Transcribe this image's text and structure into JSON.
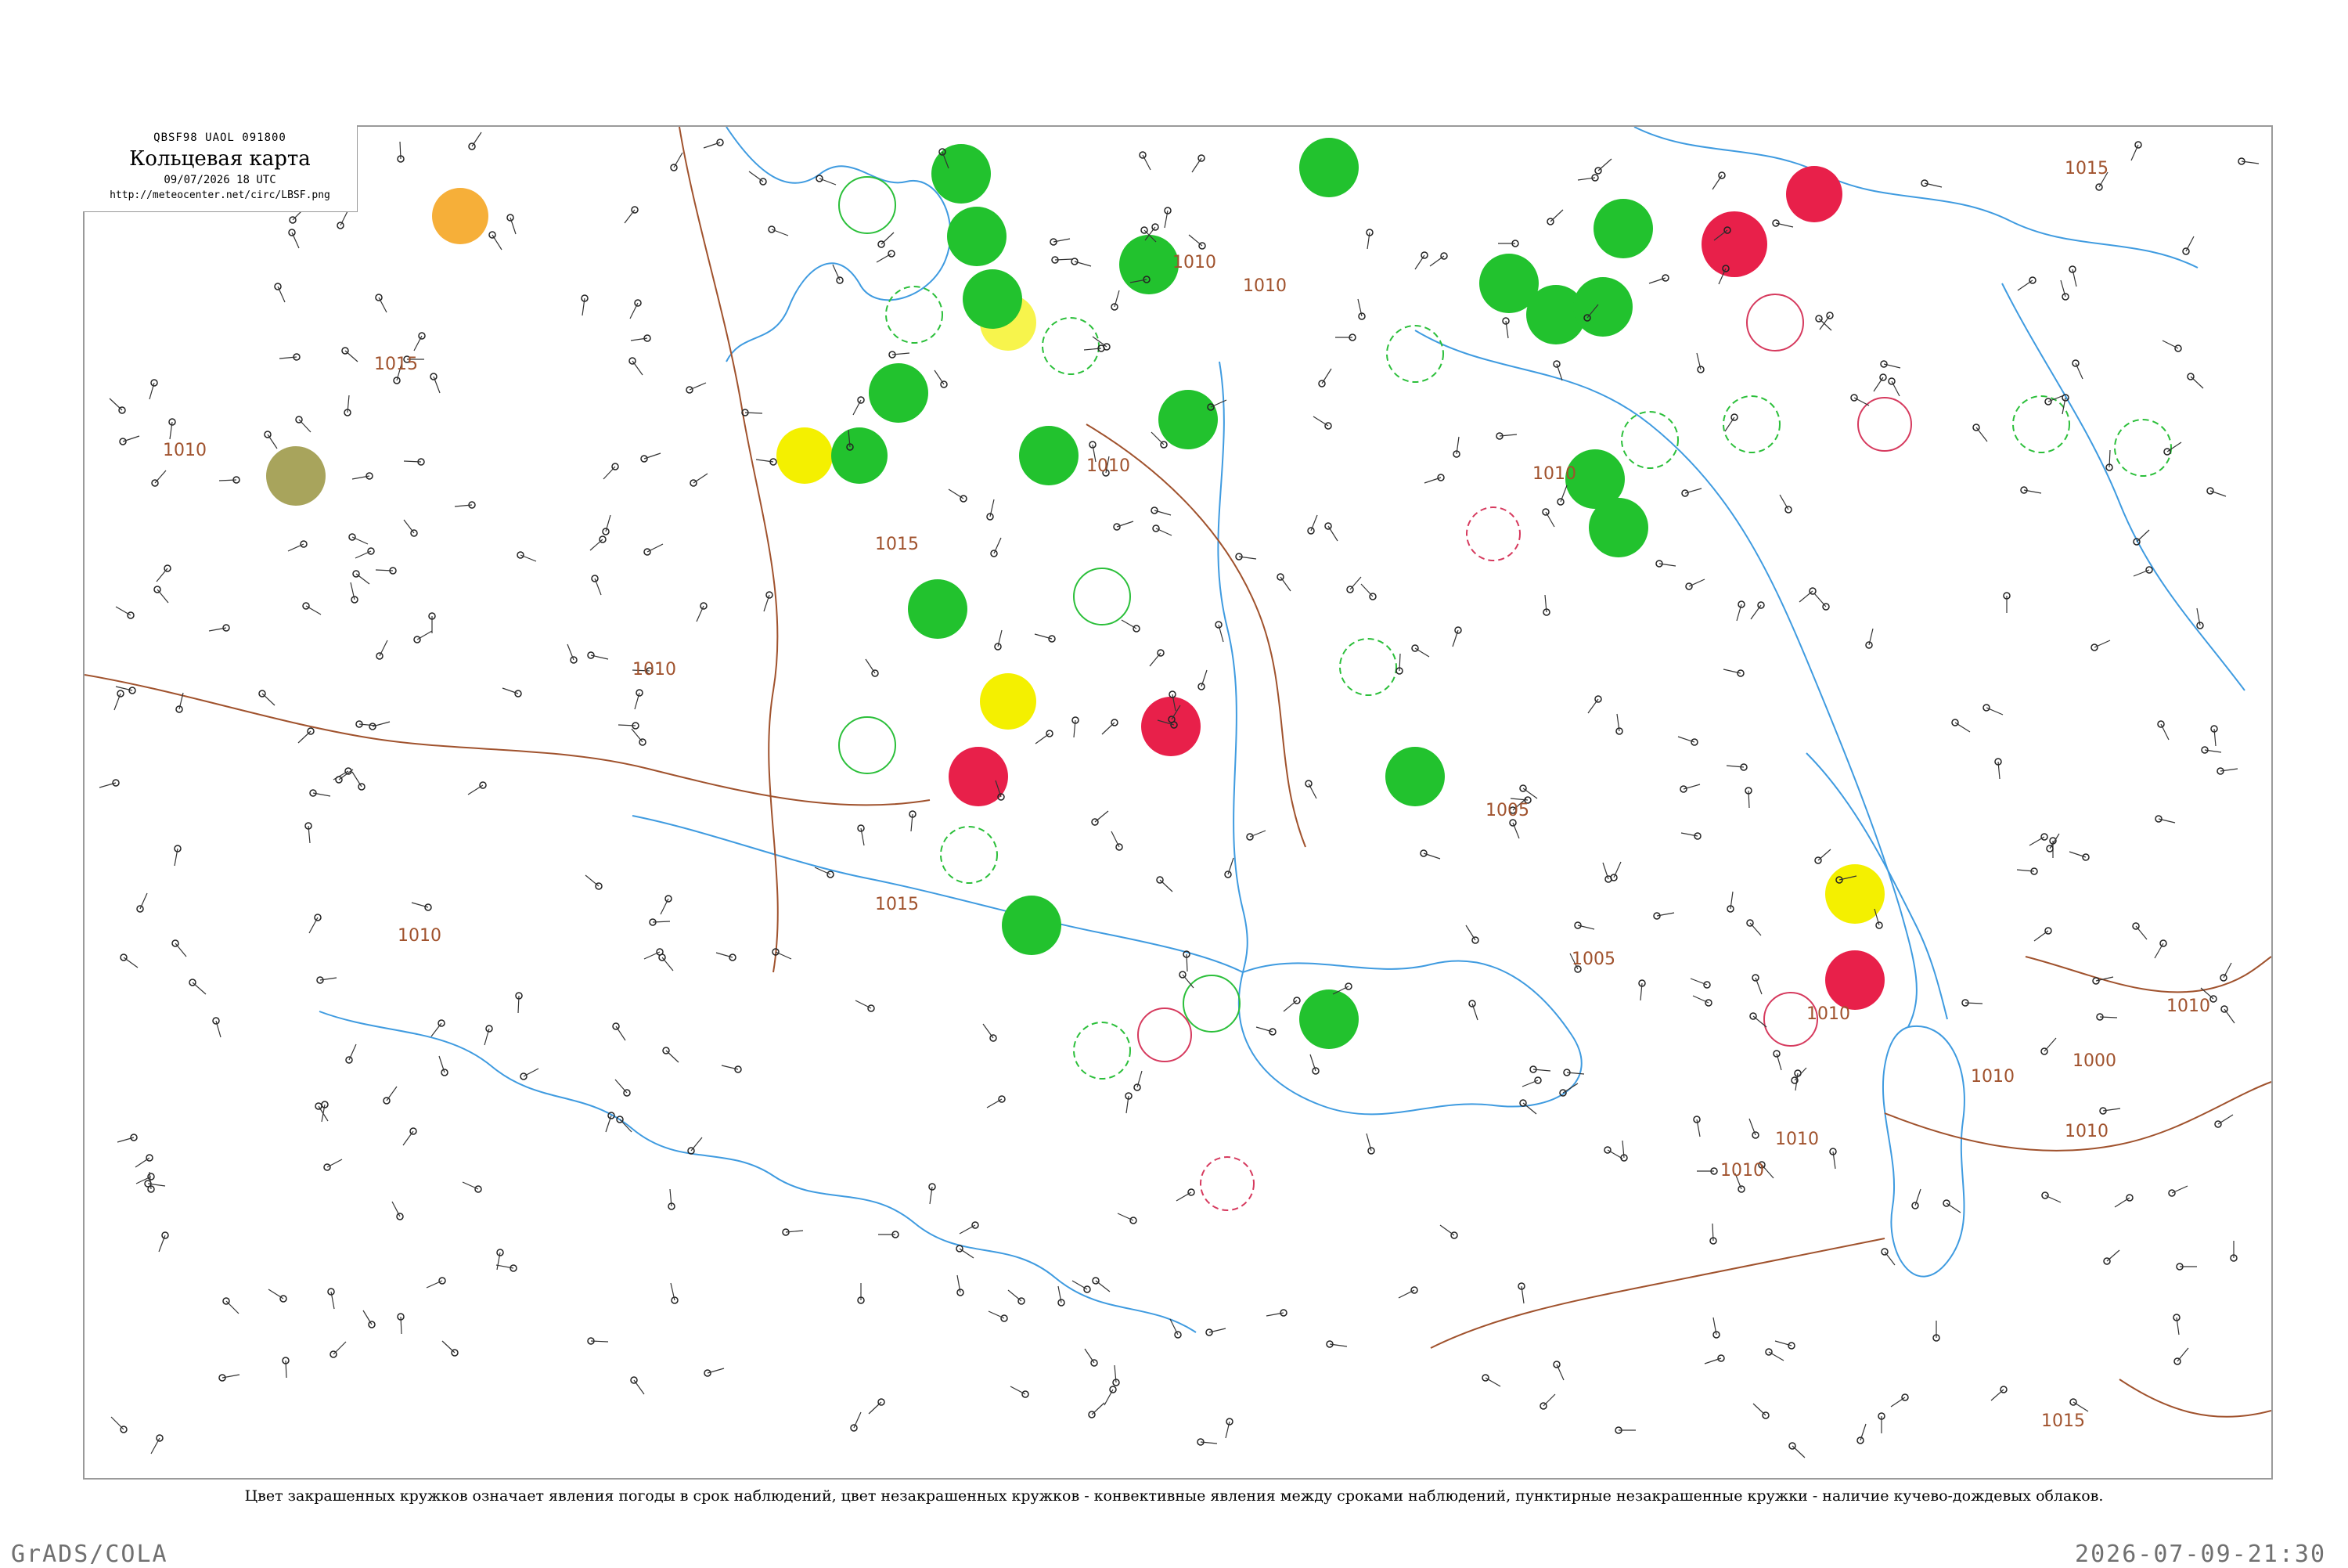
{
  "header": {
    "codes": "QBSF98  UAOL  091800",
    "title": "Кольцевая карта",
    "date": "09/07/2026 18 UTC",
    "url": "http://meteocenter.net/circ/LBSF.png"
  },
  "isobars": [
    "1015",
    "1010",
    "1010",
    "1015",
    "1010",
    "1010",
    "1015",
    "1010",
    "1010",
    "1015",
    "1010",
    "1010",
    "1010",
    "1010",
    "1005",
    "1005",
    "1000",
    "1010",
    "1010",
    "1015",
    "1010"
  ],
  "colors": {
    "fair_weather": "#f5a623",
    "haze": "#9e9a4a",
    "rain": "#22c22e",
    "drizzle_or_mist": "#f4f000",
    "thunderstorm": "#e8204a",
    "convective_ring": "#2bbf3a",
    "storm_ring": "#d63a5e",
    "coast": "#3f9be0",
    "isobar": "#a0522d"
  },
  "caption": "Цвет закрашенных кружков означает явления погоды в срок наблюдений, цвет незакрашенных кружков - конвективные явления между сроками наблюдений, пунктирные незакрашенные кружки - наличие кучево-дождевых облаков.",
  "footer": {
    "left": "GrADS/COLA",
    "right": "2026-07-09-21:30"
  }
}
